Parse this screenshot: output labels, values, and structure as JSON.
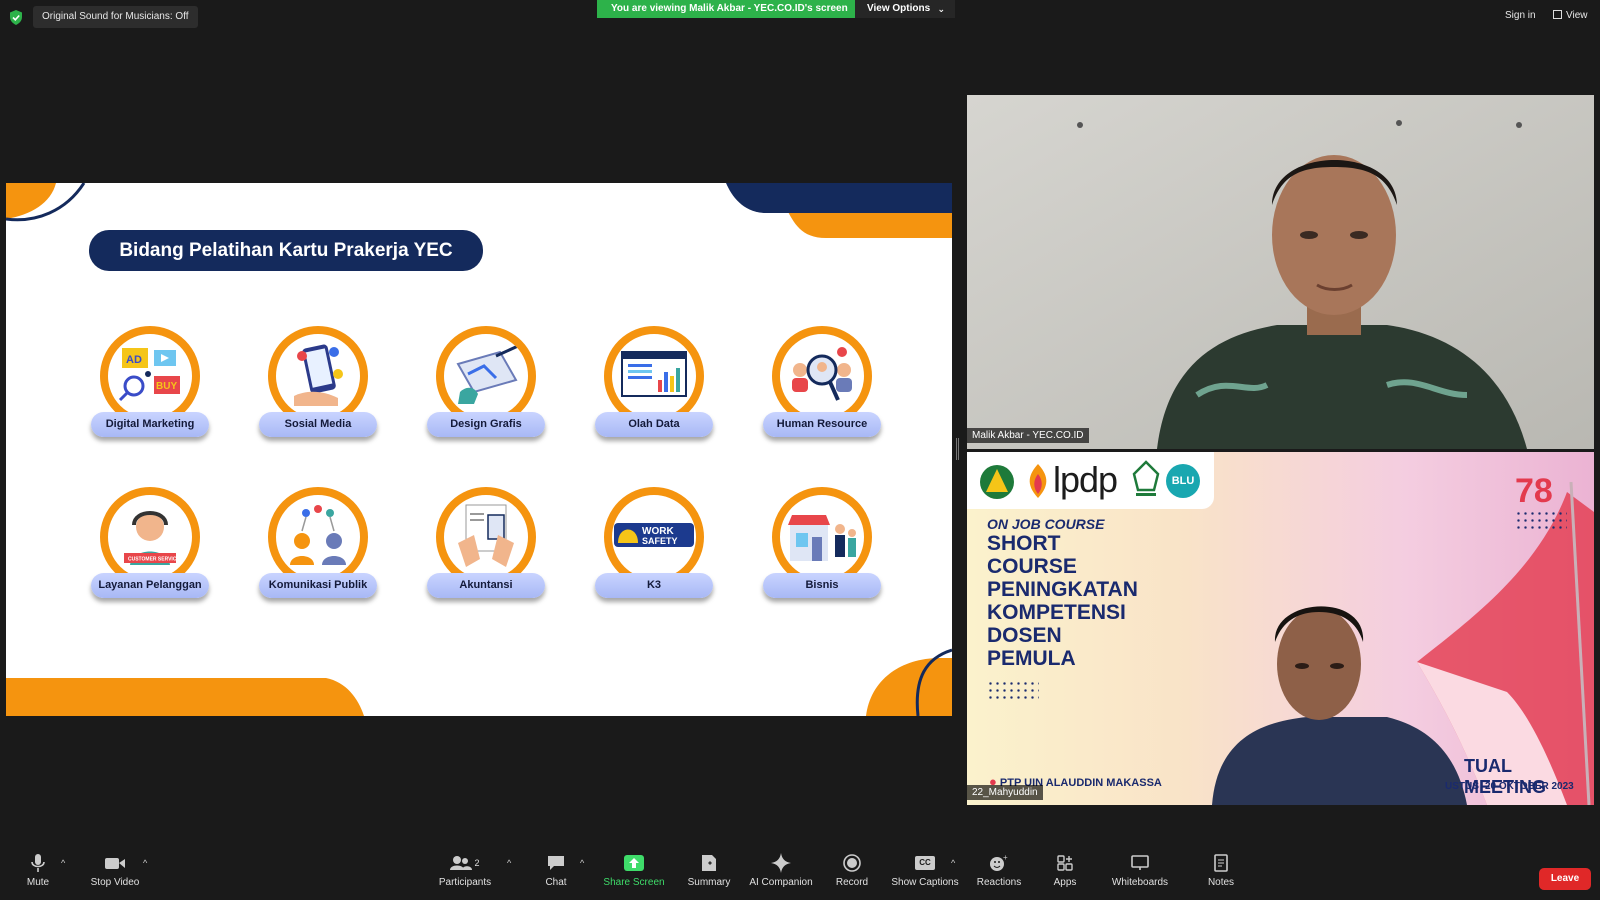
{
  "top_bar": {
    "sound_status": "Original Sound for Musicians: Off",
    "viewing_banner": "You are viewing Malik Akbar - YEC.CO.ID's screen",
    "view_options": "View Options",
    "sign_in": "Sign in",
    "view": "View"
  },
  "slide": {
    "title": "Bidang Pelatihan Kartu Prakerja YEC",
    "courses": [
      {
        "label": "Digital Marketing",
        "icon": "digital-marketing-icon"
      },
      {
        "label": "Sosial Media",
        "icon": "social-media-icon"
      },
      {
        "label": "Design Grafis",
        "icon": "design-icon"
      },
      {
        "label": "Olah Data",
        "icon": "data-icon"
      },
      {
        "label": "Human Resource",
        "icon": "hr-icon"
      },
      {
        "label": "Layanan Pelanggan",
        "icon": "customer-service-icon"
      },
      {
        "label": "Komunikasi Publik",
        "icon": "communication-icon"
      },
      {
        "label": "Akuntansi",
        "icon": "accounting-icon"
      },
      {
        "label": "K3",
        "icon": "work-safety-icon"
      },
      {
        "label": "Bisnis",
        "icon": "business-icon"
      }
    ],
    "colors": {
      "navy": "#142a5c",
      "orange": "#f5940f",
      "label_bg": "#b6c4fa"
    }
  },
  "participants": [
    {
      "name": "Malik Akbar - YEC.CO.ID"
    },
    {
      "name": "22_Mahyuddin"
    }
  ],
  "poster": {
    "logo_text": "lpdp",
    "blu": "BLU",
    "subtitle": "ON JOB COURSE",
    "lines": [
      "SHORT",
      "COURSE",
      "PENINGKATAN",
      "KOMPETENSI",
      "DOSEN",
      "PEMULA"
    ],
    "location": "PTP UIN ALAUDDIN MAKASSA",
    "meeting": "TUAL MEETING",
    "dates": "USTUS -20 OKTOBER 2023"
  },
  "toolbar": {
    "mute": "Mute",
    "stop_video": "Stop Video",
    "participants": "Participants",
    "participants_count": "2",
    "chat": "Chat",
    "share_screen": "Share Screen",
    "summary": "Summary",
    "ai_companion": "AI Companion",
    "record": "Record",
    "show_captions": "Show Captions",
    "cc": "CC",
    "reactions": "Reactions",
    "apps": "Apps",
    "whiteboards": "Whiteboards",
    "notes": "Notes",
    "leave": "Leave",
    "share_color": "#3fdc6a",
    "leave_color": "#e02828"
  }
}
